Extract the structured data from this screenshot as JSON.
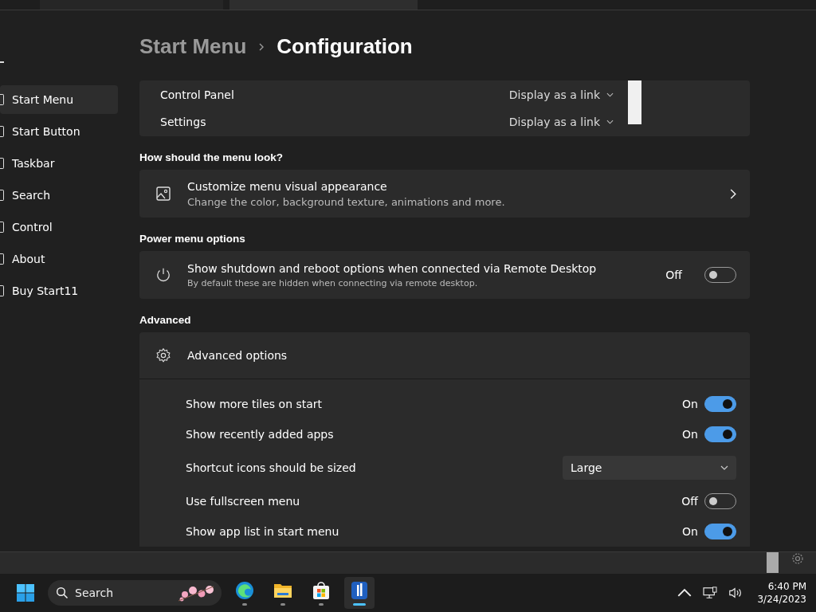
{
  "breadcrumb": {
    "parent": "Start Menu",
    "current": "Configuration"
  },
  "sidebar": {
    "items": [
      {
        "label": "Start Menu",
        "selected": true
      },
      {
        "label": "Start Button",
        "selected": false
      },
      {
        "label": "Taskbar",
        "selected": false
      },
      {
        "label": "Search",
        "selected": false
      },
      {
        "label": "Control",
        "selected": false
      },
      {
        "label": "About",
        "selected": false
      },
      {
        "label": "Buy Start11",
        "selected": false
      }
    ]
  },
  "link_rows": [
    {
      "label": "Control Panel",
      "value": "Display as a link"
    },
    {
      "label": "Settings",
      "value": "Display as a link"
    }
  ],
  "appearance": {
    "heading": "How should the menu look?",
    "title": "Customize menu visual appearance",
    "subtitle": "Change the color, background texture, animations and more."
  },
  "power": {
    "heading": "Power menu options",
    "title": "Show shutdown and reboot options when connected via Remote Desktop",
    "subtitle": "By default these are hidden when connecting via remote desktop.",
    "state": "Off",
    "on": false
  },
  "advanced": {
    "heading": "Advanced",
    "title": "Advanced options",
    "expanded": true,
    "rows": [
      {
        "kind": "toggle",
        "label": "Show more tiles on start",
        "state": "On",
        "on": true
      },
      {
        "kind": "toggle",
        "label": "Show recently added apps",
        "state": "On",
        "on": true
      },
      {
        "kind": "dropdown",
        "label": "Shortcut icons should be sized",
        "value": "Large"
      },
      {
        "kind": "toggle",
        "label": "Use fullscreen menu",
        "state": "Off",
        "on": false
      },
      {
        "kind": "toggle",
        "label": "Show app list in start menu",
        "state": "On",
        "on": true
      }
    ]
  },
  "taskbar": {
    "search_placeholder": "Search",
    "apps": [
      {
        "kind": "edge",
        "selected": false
      },
      {
        "kind": "folder",
        "selected": false
      },
      {
        "kind": "store",
        "selected": false
      },
      {
        "kind": "start11",
        "selected": true
      }
    ],
    "time": "6:40 PM",
    "date": "3/24/2023"
  }
}
